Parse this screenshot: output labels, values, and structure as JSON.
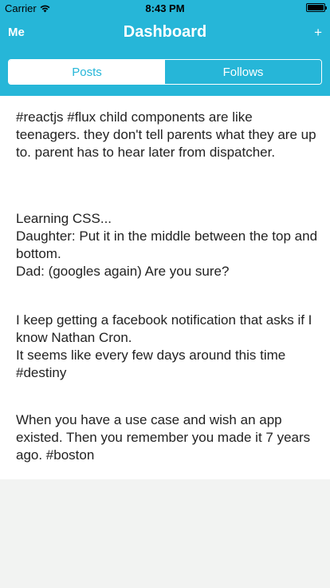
{
  "status_bar": {
    "carrier": "Carrier",
    "time": "8:43 PM",
    "wifi_icon": "wifi-icon",
    "battery_icon": "battery-icon"
  },
  "nav": {
    "left": "Me",
    "title": "Dashboard",
    "right": "+"
  },
  "tabs": [
    {
      "label": "Posts",
      "active": true
    },
    {
      "label": "Follows",
      "active": false
    }
  ],
  "posts": [
    {
      "text": "#reactjs #flux child components are like teenagers. they don't tell parents what they are up to. parent has to hear later from dispatcher."
    },
    {
      "text": "Learning CSS...\nDaughter: Put it in the middle between the top and bottom.\nDad: (googles again) Are you sure?"
    },
    {
      "text": "I keep getting a facebook notification that asks if I know Nathan Cron.\nIt seems like every few days around this time #destiny"
    },
    {
      "text": "When you have a use case and wish an app existed. Then you remember you made it 7 years ago. #boston"
    }
  ],
  "colors": {
    "accent": "#26b6d8",
    "background": "#f2f3f2",
    "text": "#222222"
  }
}
